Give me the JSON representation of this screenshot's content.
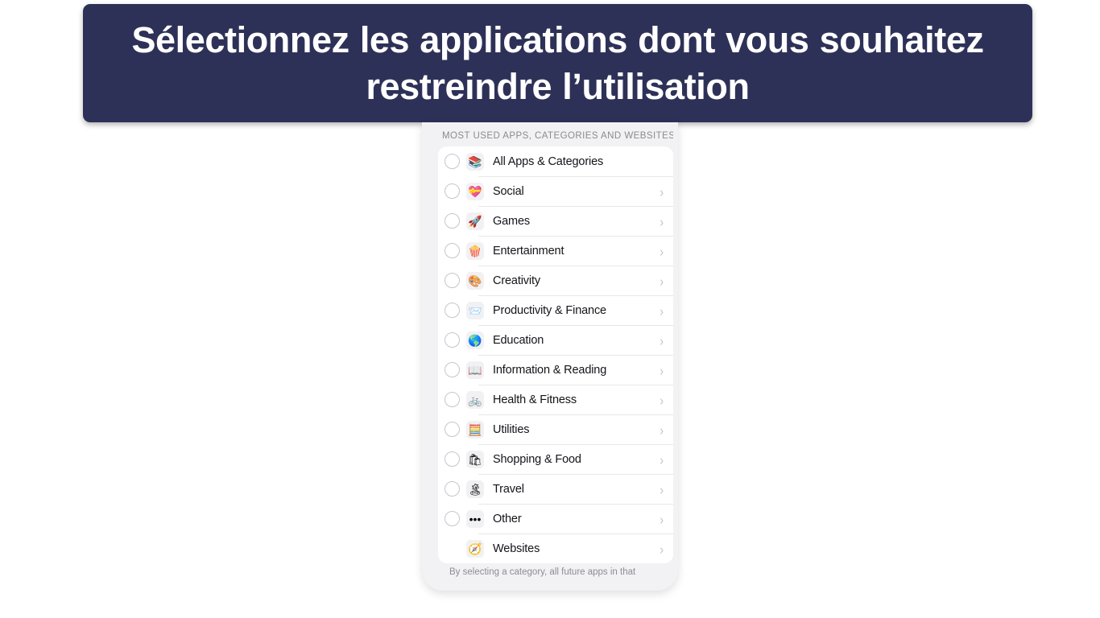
{
  "banner": {
    "title": "Sélectionnez les applications dont vous souhaitez restreindre l’utilisation",
    "background_color": "#2e3157",
    "text_color": "#ffffff"
  },
  "phone": {
    "section_header": "MOST USED APPS, CATEGORIES AND WEBSITES",
    "footer_note": "By selecting a category, all future apps in that",
    "list": [
      {
        "label": "All Apps & Categories",
        "icon": "stack-icon",
        "glyph": "📚",
        "radio": true,
        "chevron": false
      },
      {
        "label": "Social",
        "icon": "chat-heart-icon",
        "glyph": "💝",
        "radio": true,
        "chevron": true
      },
      {
        "label": "Games",
        "icon": "rocket-icon",
        "glyph": "🚀",
        "radio": true,
        "chevron": true
      },
      {
        "label": "Entertainment",
        "icon": "popcorn-icon",
        "glyph": "🍿",
        "radio": true,
        "chevron": true
      },
      {
        "label": "Creativity",
        "icon": "palette-icon",
        "glyph": "🎨",
        "radio": true,
        "chevron": true
      },
      {
        "label": "Productivity & Finance",
        "icon": "paper-plane-icon",
        "glyph": "📨",
        "radio": true,
        "chevron": true
      },
      {
        "label": "Education",
        "icon": "globe-icon",
        "glyph": "🌎",
        "radio": true,
        "chevron": true
      },
      {
        "label": "Information & Reading",
        "icon": "open-book-icon",
        "glyph": "📖",
        "radio": true,
        "chevron": true
      },
      {
        "label": "Health & Fitness",
        "icon": "bicycle-icon",
        "glyph": "🚲",
        "radio": true,
        "chevron": true
      },
      {
        "label": "Utilities",
        "icon": "calculator-icon",
        "glyph": "🧮",
        "radio": true,
        "chevron": true
      },
      {
        "label": "Shopping & Food",
        "icon": "shopping-bag-icon",
        "glyph": "🛍",
        "radio": true,
        "chevron": true
      },
      {
        "label": "Travel",
        "icon": "island-icon",
        "glyph": "🏝",
        "radio": true,
        "chevron": true
      },
      {
        "label": "Other",
        "icon": "ellipsis-icon",
        "glyph": "•••",
        "radio": true,
        "chevron": true
      },
      {
        "label": "Websites",
        "icon": "compass-icon",
        "glyph": "🧭",
        "radio": false,
        "chevron": true
      }
    ]
  },
  "chevron_glyph": "›"
}
